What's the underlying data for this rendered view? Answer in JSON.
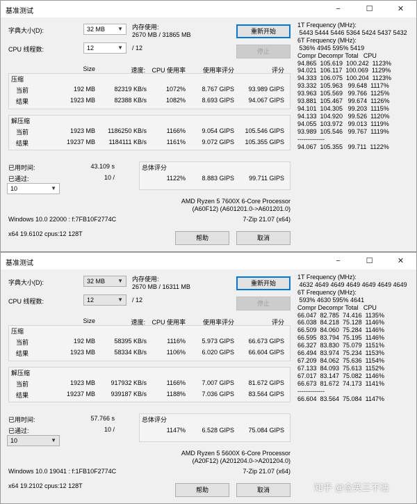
{
  "windows": [
    {
      "title": "基准测试",
      "dict_label": "字典大小(D):",
      "dict_value": "32 MB",
      "mem_label": "内存使用:",
      "mem_value": "2670 MB / 31865 MB",
      "threads_label": "CPU 线程数:",
      "threads_value": "12",
      "threads_total": "/ 12",
      "restart_button": "重新开始",
      "stop_button": "停止",
      "headers": {
        "size": "Size",
        "speed": "速度:",
        "cpu": "CPU 使用率",
        "rating": "使用率评分",
        "score": "评分"
      },
      "compress_label": "压缩",
      "decompress_label": "解压缩",
      "rows": {
        "c_current": {
          "label": "当前",
          "size": "192 MB",
          "speed": "82319 KB/s",
          "cpu": "1072%",
          "rating": "8.767 GIPS",
          "score": "93.989 GIPS"
        },
        "c_result": {
          "label": "结果",
          "size": "1923 MB",
          "speed": "82388 KB/s",
          "cpu": "1082%",
          "rating": "8.693 GIPS",
          "score": "94.067 GIPS"
        },
        "d_current": {
          "label": "当前",
          "size": "1923 MB",
          "speed": "1186250 KB/s",
          "cpu": "1166%",
          "rating": "9.054 GIPS",
          "score": "105.546 GIPS"
        },
        "d_result": {
          "label": "结果",
          "size": "19237 MB",
          "speed": "1184111 KB/s",
          "cpu": "1161%",
          "rating": "9.072 GIPS",
          "score": "105.355 GIPS"
        }
      },
      "elapsed_label": "已用时间:",
      "elapsed_value": "43.109 s",
      "passed_label": "已通过:",
      "passed_value": "10 /",
      "passes_value": "10",
      "total_label": "总体评分",
      "total_cpu": "1122%",
      "total_rating": "8.883 GIPS",
      "total_score": "99.711 GIPS",
      "cpu_name": "AMD Ryzen 5 7600X 6-Core Processor",
      "cpu_id": "(A60F12) (A601201.0->A601201.0)",
      "version": "7-Zip 21.07 (x64)",
      "os": "Windows 10.0 22000 : f:7FB10F2774C",
      "arch": "x64 19.6102 cpus:12 128T",
      "help_button": "帮助",
      "cancel_button": "取消",
      "freq_text": "1T Frequency (MHz):\n 5443 5444 5446 5364 5424 5437 5432\n6T Frequency (MHz):\n 536% 4945 595% 5419\nCompr Decompr Total   CPU\n94.865  105.619  100.242  1123%\n94.021  106.117  100.069  1129%\n94.333  106.075  100.204  1123%\n93.332  105.963   99.648  1117%\n93.963  105.569   99.766  1125%\n93.881  105.467   99.674  1126%\n94.101  104.305   99.203  1115%\n94.133  104.920   99.526  1120%\n94.055  103.972   99.013  1119%\n93.989  105.546   99.767  1119%\n-------------\n94.067  105.355   99.711  1122%"
    },
    {
      "title": "基准测试",
      "dict_label": "字典大小(D):",
      "dict_value": "32 MB",
      "mem_label": "内存使用:",
      "mem_value": "2670 MB / 16311 MB",
      "threads_label": "CPU 线程数:",
      "threads_value": "12",
      "threads_total": "/ 12",
      "restart_button": "重新开始",
      "stop_button": "停止",
      "headers": {
        "size": "Size",
        "speed": "速度:",
        "cpu": "CPU 使用率",
        "rating": "使用率评分",
        "score": "评分"
      },
      "compress_label": "压缩",
      "decompress_label": "解压缩",
      "rows": {
        "c_current": {
          "label": "当前",
          "size": "192 MB",
          "speed": "58395 KB/s",
          "cpu": "1116%",
          "rating": "5.973 GIPS",
          "score": "66.673 GIPS"
        },
        "c_result": {
          "label": "结果",
          "size": "1923 MB",
          "speed": "58334 KB/s",
          "cpu": "1106%",
          "rating": "6.020 GIPS",
          "score": "66.604 GIPS"
        },
        "d_current": {
          "label": "当前",
          "size": "1923 MB",
          "speed": "917932 KB/s",
          "cpu": "1166%",
          "rating": "7.007 GIPS",
          "score": "81.672 GIPS"
        },
        "d_result": {
          "label": "结果",
          "size": "19237 MB",
          "speed": "939187 KB/s",
          "cpu": "1188%",
          "rating": "7.036 GIPS",
          "score": "83.564 GIPS"
        }
      },
      "elapsed_label": "已用时间:",
      "elapsed_value": "57.766 s",
      "passed_label": "已通过:",
      "passed_value": "10 /",
      "passes_value": "10",
      "total_label": "总体评分",
      "total_cpu": "1147%",
      "total_rating": "6.528 GIPS",
      "total_score": "75.084 GIPS",
      "cpu_name": "AMD Ryzen 5 5600X 6-Core Processor",
      "cpu_id": "(A20F12) (A201204.0->A201204.0)",
      "version": "7-Zip 21.07 (x64)",
      "os": "Windows 10.0 19041 : f:1FB10F2774C",
      "arch": "x64 19.2102 cpus:12 128T",
      "help_button": "帮助",
      "cancel_button": "取消",
      "freq_text": "1T Frequency (MHz):\n 4632 4649 4649 4649 4649 4649 4649\n6T Frequency (MHz):\n 593% 4630 595% 4641\nCompr Decompr Total   CPU\n66.047  82.785  74.416  1135%\n66.038  84.218  75.128  1146%\n66.509  84.060  75.284  1146%\n66.595  83.794  75.195  1146%\n66.327  83.830  75.079  1151%\n66.494  83.974  75.234  1153%\n67.209  84.062  75.636  1154%\n67.133  84.093  75.613  1152%\n67.017  83.147  75.082  1146%\n66.673  81.672  74.173  1141%\n-------------\n66.604  83.564  75.084  1147%"
    }
  ],
  "icons": {
    "minimize": "−",
    "maximize": "☐",
    "close": "✕",
    "dropdown": "▼"
  },
  "watermark": "知乎 @含笑三不沽",
  "colors": {
    "accent": "#0078d7",
    "window_bg": "#f0f0f0",
    "titlebar": "#ffffff"
  }
}
